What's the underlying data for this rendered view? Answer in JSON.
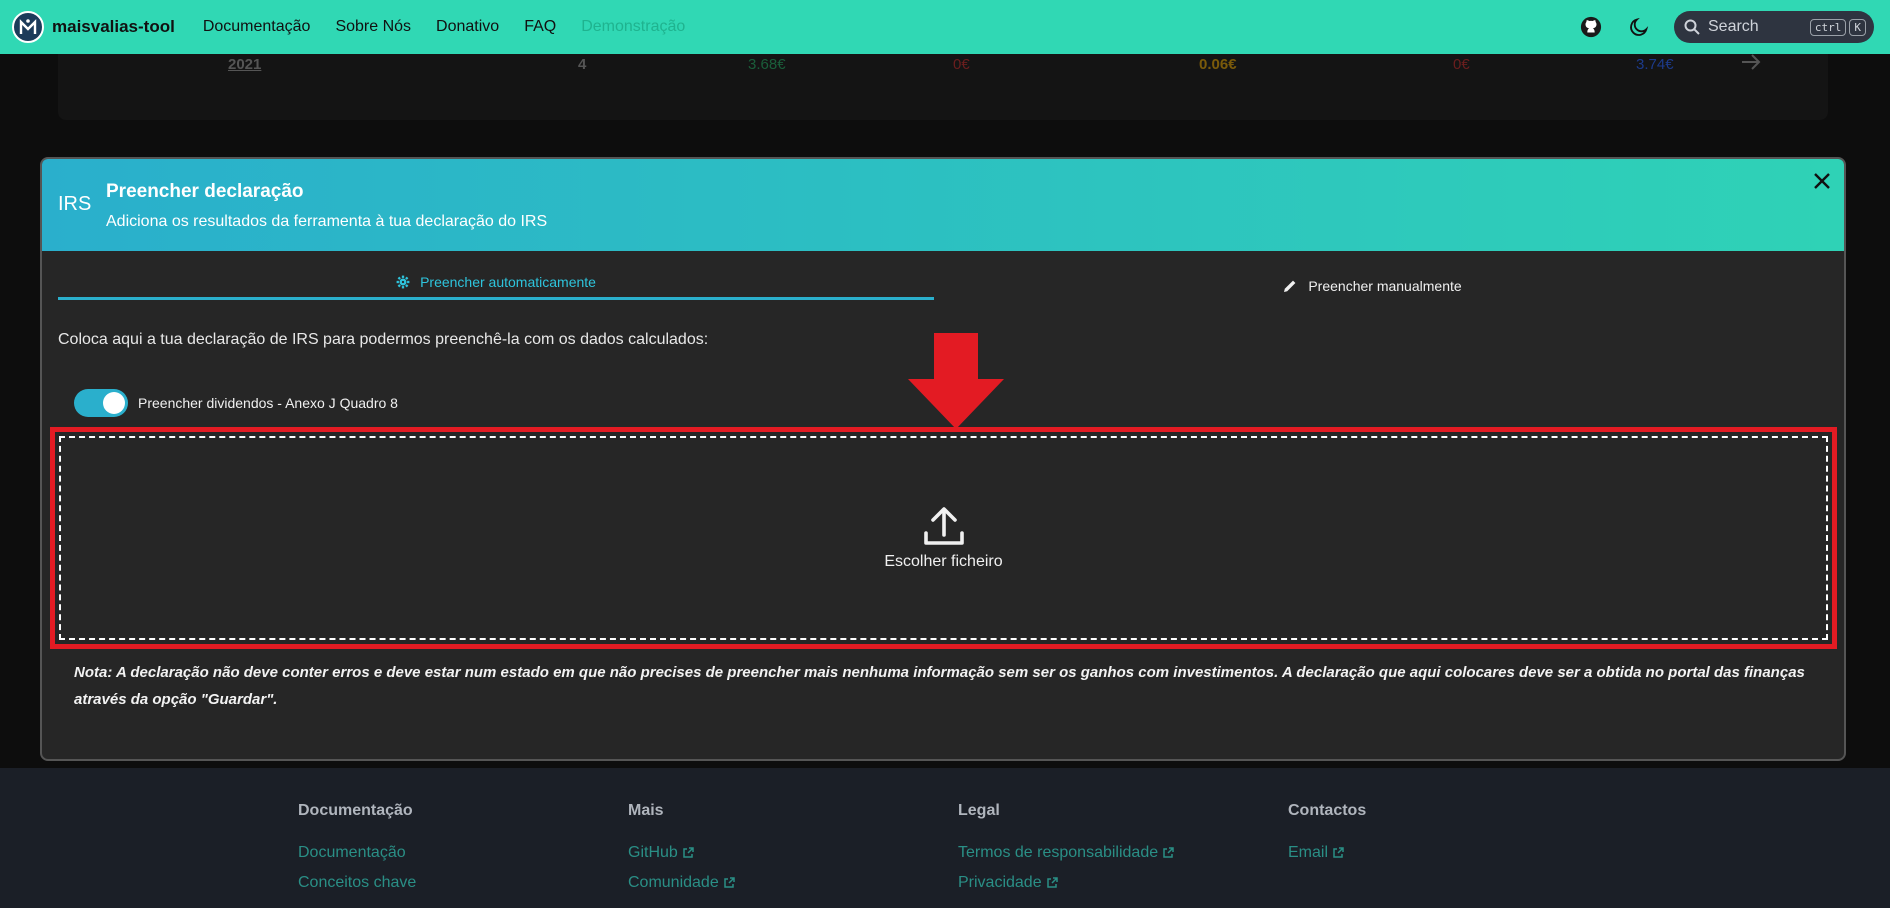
{
  "navbar": {
    "brand": "maisvalias-tool",
    "links": [
      "Documentação",
      "Sobre Nós",
      "Donativo",
      "FAQ",
      "Demonstração"
    ],
    "search_placeholder": "Search",
    "kbd_ctrl": "ctrl",
    "kbd_k": "K"
  },
  "background_row": {
    "year": "2021",
    "count": "4",
    "v1": "3.68€",
    "v2": "0€",
    "v3": "0.06€",
    "v4": "0€",
    "v5": "3.74€"
  },
  "modal": {
    "irs_label": "IRS",
    "title": "Preencher declaração",
    "subtitle": "Adiciona os resultados da ferramenta à tua declaração do IRS",
    "tabs": [
      {
        "label": "Preencher automaticamente",
        "icon": "gear-icon",
        "active": true
      },
      {
        "label": "Preencher manualmente",
        "icon": "pencil-icon",
        "active": false
      }
    ],
    "instruction": "Coloca aqui a tua declaração de IRS para podermos preenchê-la com os dados calculados:",
    "toggle_label": "Preencher dividendos - Anexo J Quadro 8",
    "toggle_on": true,
    "upload_label": "Escolher ficheiro",
    "note": "Nota: A declaração não deve conter erros e deve estar num estado em que não precises de preencher mais nenhuma informação sem ser os ganhos com investimentos. A declaração que aqui colocares deve ser a obtida no portal das finanças através da opção \"Guardar\"."
  },
  "footer": {
    "columns": [
      {
        "heading": "Documentação",
        "links": [
          "Documentação",
          "Conceitos chave"
        ]
      },
      {
        "heading": "Mais",
        "links": [
          "GitHub",
          "Comunidade"
        ]
      },
      {
        "heading": "Legal",
        "links": [
          "Termos de responsabilidade",
          "Privacidade"
        ]
      },
      {
        "heading": "Contactos",
        "links": [
          "Email"
        ]
      }
    ]
  },
  "colors": {
    "accent": "#30d8b4",
    "modal_accent": "#2aafcc",
    "highlight_red": "#e31b23"
  }
}
